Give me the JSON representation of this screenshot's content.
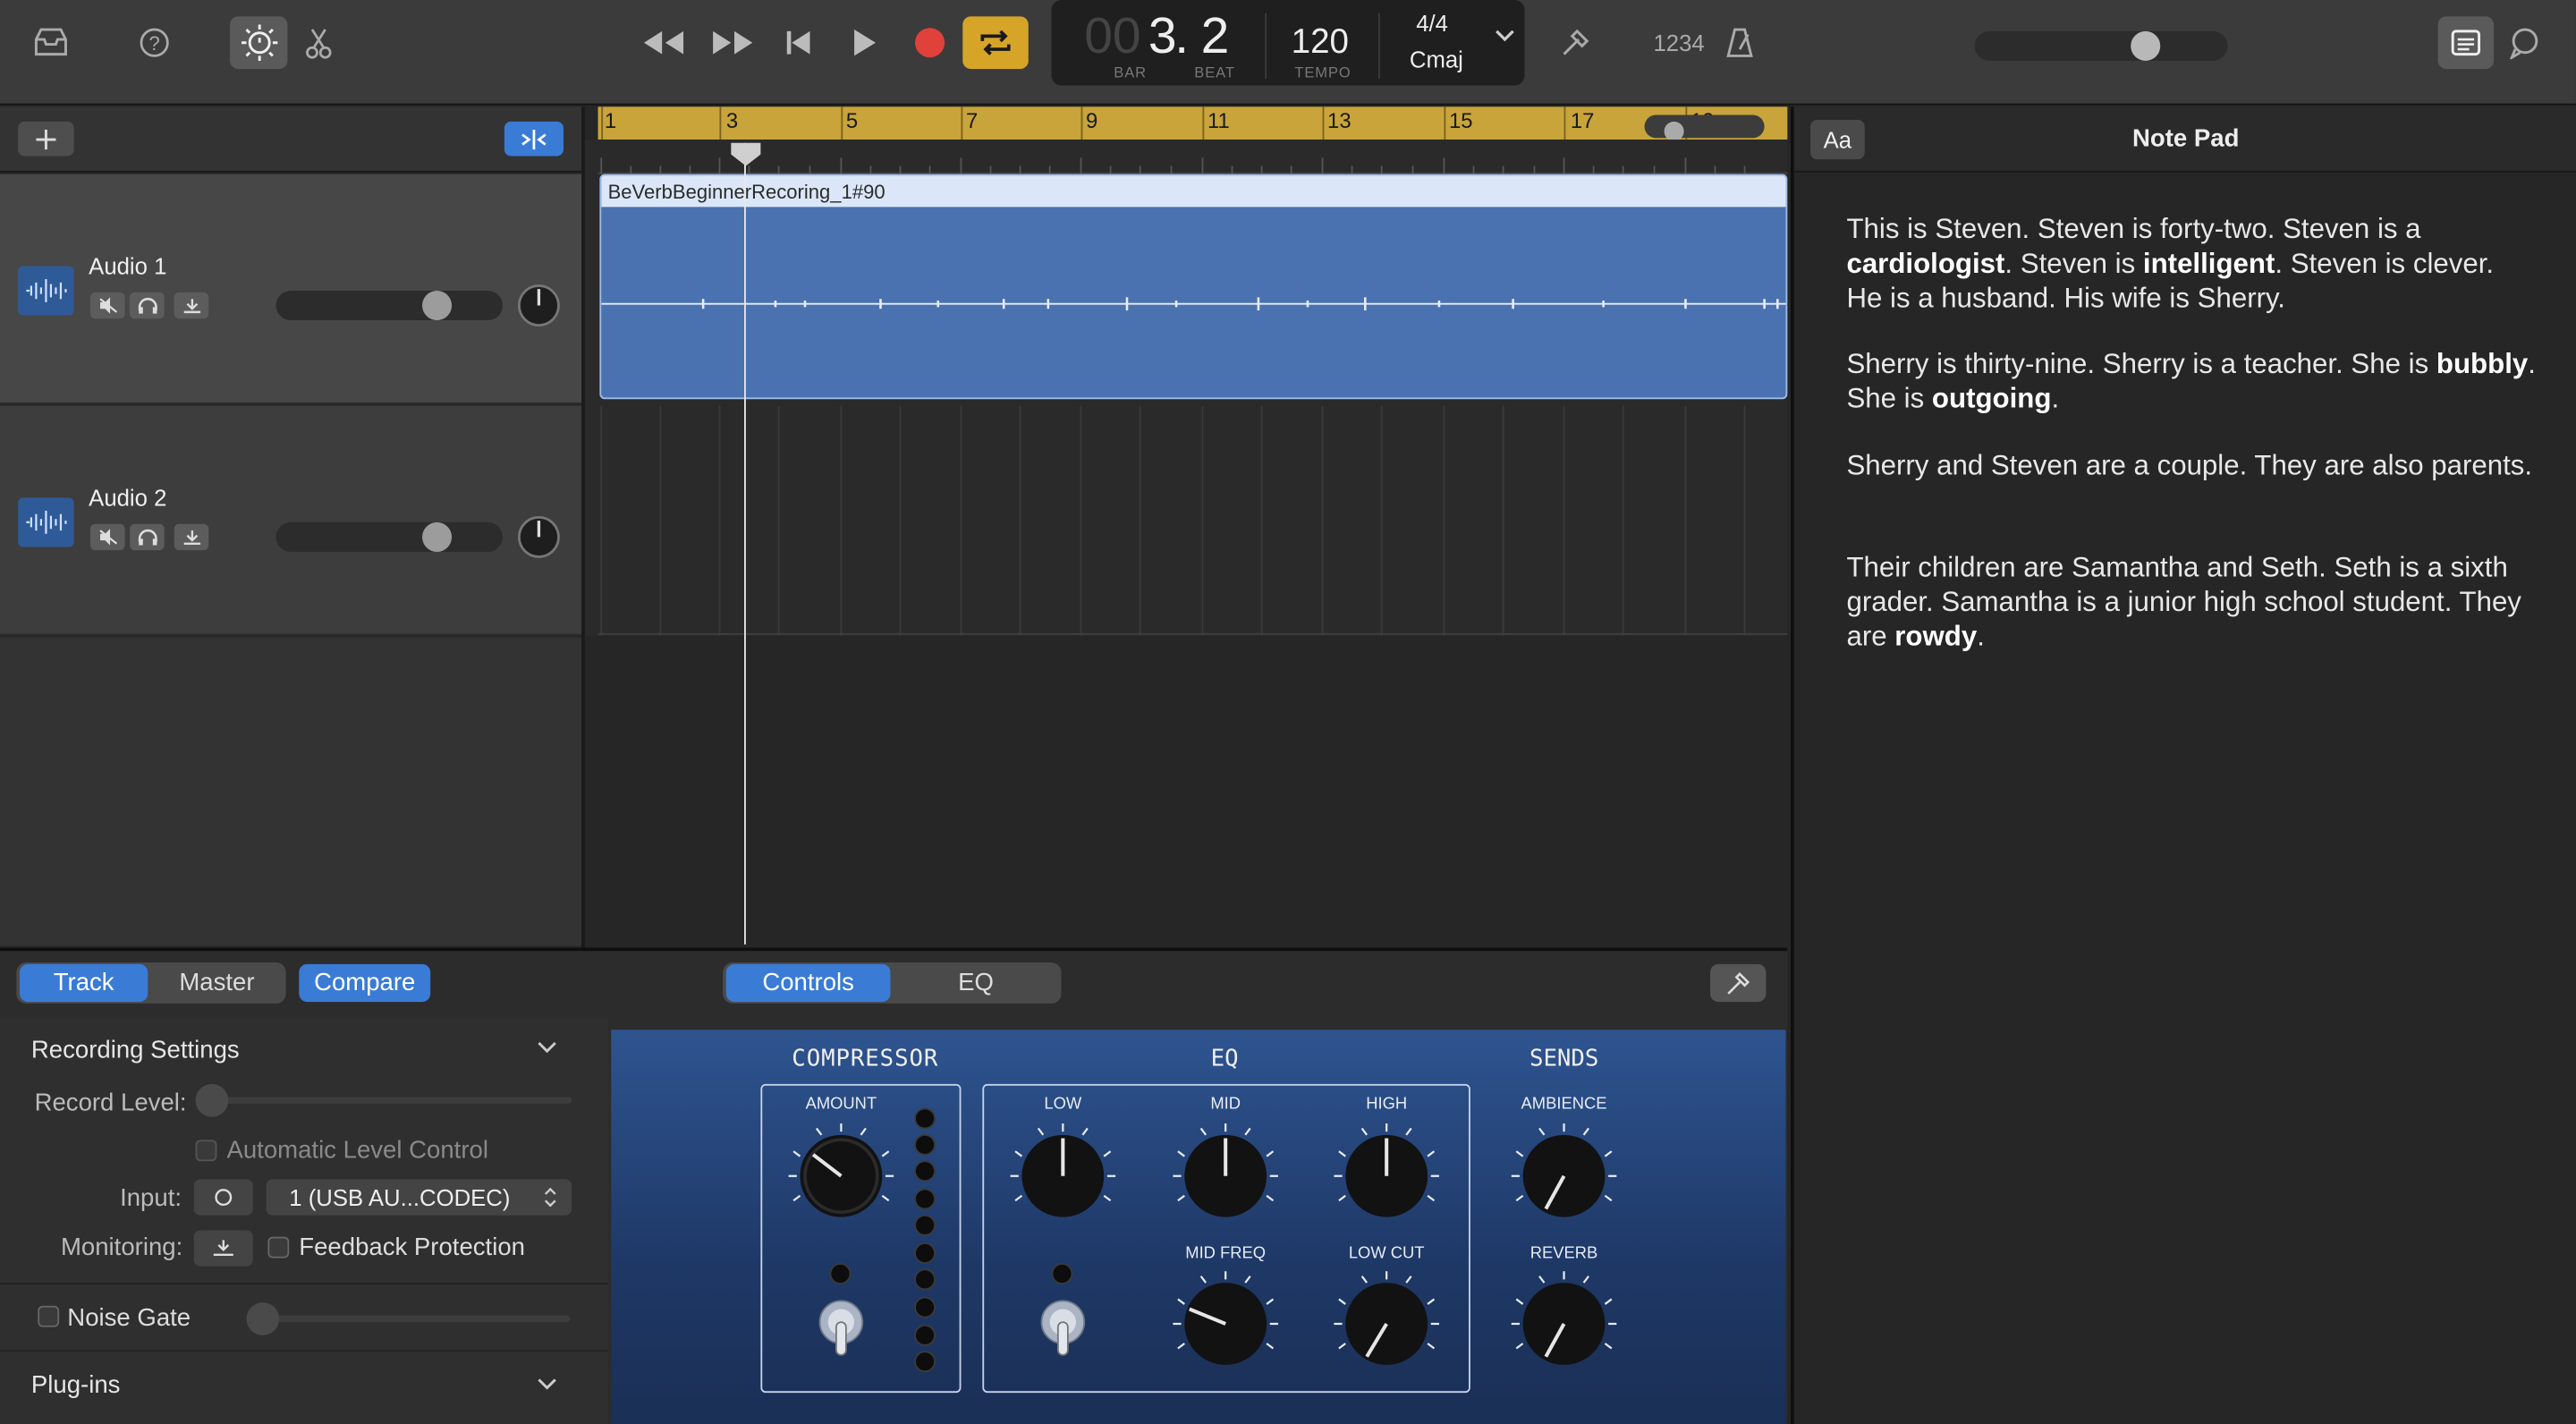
{
  "toolbar": {
    "icons": [
      "library-icon",
      "help-icon",
      "smart-controls-icon",
      "scissors-icon",
      "rewind-icon",
      "fast-forward-icon",
      "go-to-start-icon",
      "play-icon",
      "record-icon",
      "cycle-icon",
      "tuner-icon",
      "count-in-icon",
      "metronome-icon",
      "notepad-icon",
      "loop-browser-icon"
    ],
    "count_in_label": "1234",
    "colors": {
      "cycle": "#d6a528",
      "record": "#e0413a"
    }
  },
  "lcd": {
    "bar_prefix": "00",
    "bar": "3",
    "beat": "2",
    "bar_label": "BAR",
    "beat_label": "BEAT",
    "tempo": "120",
    "tempo_label": "TEMPO",
    "time_signature": "4/4",
    "key": "Cmaj"
  },
  "tracks": [
    {
      "name": "Audio 1",
      "volume": 0.72
    },
    {
      "name": "Audio 2",
      "volume": 0.72
    }
  ],
  "ruler": {
    "bars": [
      "1",
      "3",
      "5",
      "7",
      "9",
      "11",
      "13",
      "15",
      "17",
      "19"
    ]
  },
  "region": {
    "name": "BeVerbBeginnerRecoring_1#90",
    "color": "#4a72b0"
  },
  "bottom_tabs": {
    "track": "Track",
    "master": "Master",
    "compare": "Compare",
    "controls": "Controls",
    "eq": "EQ"
  },
  "recording_settings": {
    "title": "Recording Settings",
    "record_level_label": "Record Level:",
    "automatic_level_control": "Automatic Level Control",
    "input_label": "Input:",
    "input_value": "1  (USB AU...CODEC)",
    "monitoring_label": "Monitoring:",
    "feedback_protection": "Feedback Protection",
    "noise_gate": "Noise Gate",
    "plugins": "Plug-ins"
  },
  "plugin": {
    "compressor_title": "COMPRESSOR",
    "eq_title": "EQ",
    "sends_title": "SENDS",
    "knobs": {
      "amount": "AMOUNT",
      "low": "LOW",
      "mid": "MID",
      "high": "HIGH",
      "mid_freq": "MID FREQ",
      "low_cut": "LOW CUT",
      "ambience": "AMBIENCE",
      "reverb": "REVERB"
    }
  },
  "notepad": {
    "font_button": "Aa",
    "title": "Note Pad",
    "p1": [
      {
        "t": "This is Steven. Steven is forty-two. Steven is a "
      },
      {
        "t": "cardiologist",
        "b": true
      },
      {
        "t": ". Steven is "
      },
      {
        "t": "intelligent",
        "b": true
      },
      {
        "t": ". Steven is clever. He is a husband. His wife is Sherry."
      }
    ],
    "p2": [
      {
        "t": "Sherry is thirty-nine. Sherry is a teacher. She is "
      },
      {
        "t": "bubbly",
        "b": true
      },
      {
        "t": ". She is "
      },
      {
        "t": "outgoing",
        "b": true
      },
      {
        "t": "."
      }
    ],
    "p3": [
      {
        "t": "Sherry and Steven are a couple. They are also parents."
      }
    ],
    "p4": [
      {
        "t": "Their children are Samantha and Seth. Seth is a sixth grader. Samantha is a junior high school student. They are "
      },
      {
        "t": "rowdy",
        "b": true
      },
      {
        "t": "."
      }
    ]
  }
}
